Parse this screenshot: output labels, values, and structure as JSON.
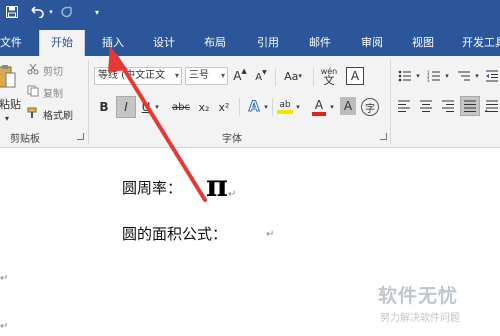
{
  "tabs": [
    {
      "label": "文件",
      "active": false
    },
    {
      "label": "开始",
      "active": true
    },
    {
      "label": "插入",
      "active": false
    },
    {
      "label": "设计",
      "active": false
    },
    {
      "label": "布局",
      "active": false
    },
    {
      "label": "引用",
      "active": false
    },
    {
      "label": "邮件",
      "active": false
    },
    {
      "label": "审阅",
      "active": false
    },
    {
      "label": "视图",
      "active": false
    },
    {
      "label": "开发工具",
      "active": false
    }
  ],
  "clipboard": {
    "paste_label": "粘贴",
    "cut_label": "剪切",
    "copy_label": "复制",
    "format_painter_label": "格式刷",
    "group_label": "剪贴板"
  },
  "font": {
    "font_name": "等线 (中文正文",
    "font_size": "三号",
    "group_label": "字体",
    "grow_label": "A",
    "shrink_label": "A",
    "case_label": "Aa",
    "phonetic_label": "wén",
    "border_char_label": "A",
    "bold_label": "B",
    "italic_label": "I",
    "underline_label": "U",
    "strike_label": "abc",
    "sub_label": "x₂",
    "sup_label": "x²",
    "effects_label": "A",
    "highlight_label": "ab",
    "color_label": "A",
    "shading_label": "A",
    "enclose_label": "字"
  },
  "document": {
    "line1_text": "圆周率：",
    "pi_symbol": "π",
    "line2_text": "圆的面积公式：",
    "paragraph_mark": "↵"
  },
  "watermark": {
    "main": "软件无忧",
    "sub": "努力解决软件问题"
  },
  "colors": {
    "accent": "#2b579a",
    "arrow": "#e53935",
    "highlight_yellow": "#f5e400",
    "font_red": "#e0231b"
  }
}
